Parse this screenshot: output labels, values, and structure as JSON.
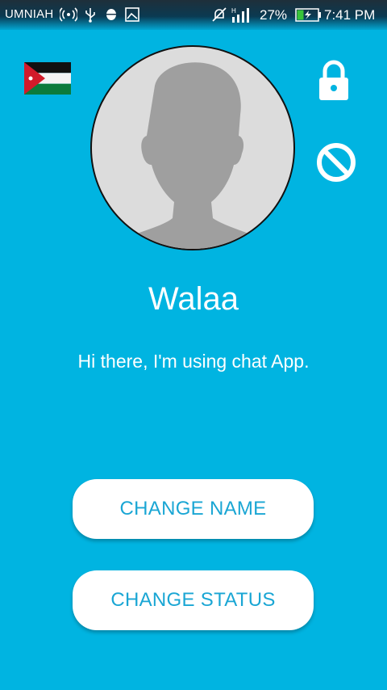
{
  "status_bar": {
    "carrier": "UMNIAH",
    "battery_percent": "27%",
    "time": "7:41 PM",
    "icons": [
      "wifi-hotspot-icon",
      "usb-icon",
      "android-debug-icon",
      "gallery-icon",
      "mute-icon",
      "signal-h-icon",
      "battery-charging-icon"
    ]
  },
  "profile": {
    "country_flag": "jordan-flag-icon",
    "name": "Walaa",
    "status": "Hi there, I'm using chat App."
  },
  "actions": {
    "change_name_label": "CHANGE NAME",
    "change_status_label": "CHANGE STATUS"
  },
  "colors": {
    "background": "#00b4e1",
    "button_text": "#1aa6d4",
    "button_bg": "#ffffff",
    "text": "#ffffff"
  }
}
